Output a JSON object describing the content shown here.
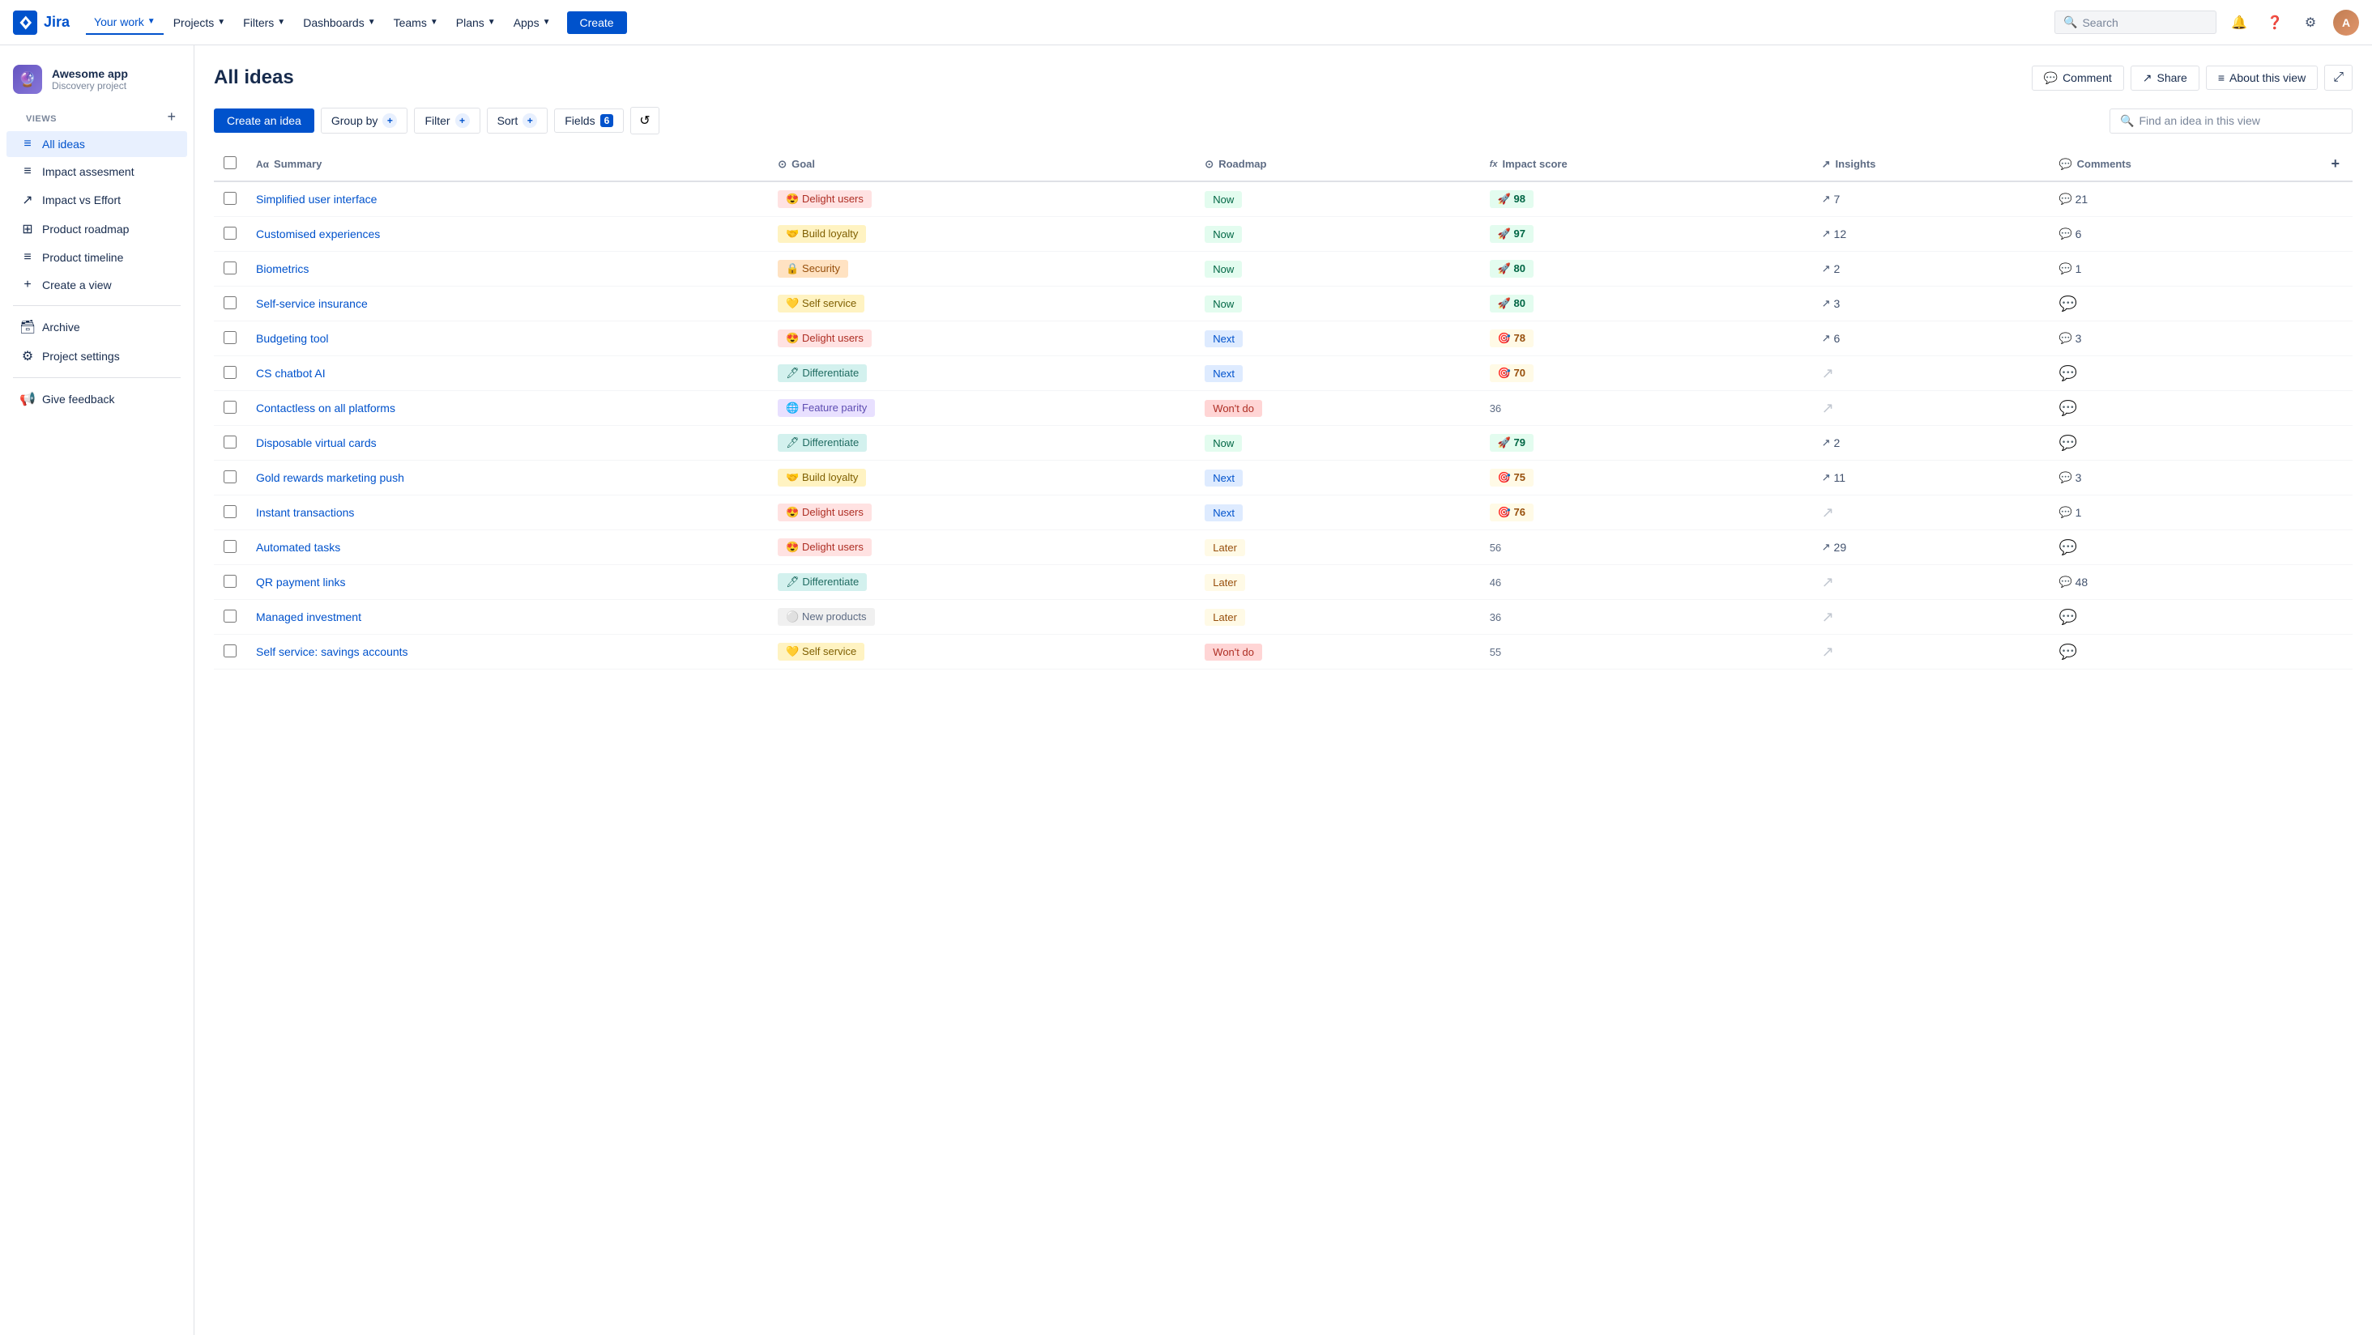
{
  "topnav": {
    "logo_text": "Jira",
    "menu": [
      {
        "label": "Your work",
        "active": true,
        "has_chevron": true
      },
      {
        "label": "Projects",
        "has_chevron": true
      },
      {
        "label": "Filters",
        "has_chevron": true
      },
      {
        "label": "Dashboards",
        "has_chevron": true
      },
      {
        "label": "Teams",
        "has_chevron": true
      },
      {
        "label": "Plans",
        "has_chevron": true
      },
      {
        "label": "Apps",
        "has_chevron": true
      }
    ],
    "create_label": "Create",
    "search_placeholder": "Search"
  },
  "sidebar": {
    "project_name": "Awesome app",
    "project_type": "Discovery project",
    "views_label": "VIEWS",
    "add_view_label": "+",
    "nav_items": [
      {
        "id": "all-ideas",
        "label": "All ideas",
        "icon": "≡",
        "active": true
      },
      {
        "id": "impact-assessment",
        "label": "Impact assesment",
        "icon": "≡"
      },
      {
        "id": "impact-vs-effort",
        "label": "Impact vs Effort",
        "icon": "↗"
      },
      {
        "id": "product-roadmap",
        "label": "Product roadmap",
        "icon": "⊞"
      },
      {
        "id": "product-timeline",
        "label": "Product timeline",
        "icon": "≡"
      },
      {
        "id": "create-view",
        "label": "Create a view",
        "icon": "+"
      }
    ],
    "archive_label": "Archive",
    "project_settings_label": "Project settings",
    "give_feedback_label": "Give feedback"
  },
  "main": {
    "title": "All ideas",
    "header_buttons": {
      "comment": "Comment",
      "share": "Share",
      "about": "About this view",
      "expand": "⤢"
    },
    "toolbar": {
      "create_idea": "Create an idea",
      "group_by": "Group by",
      "filter": "Filter",
      "sort": "Sort",
      "fields": "Fields",
      "fields_count": "6",
      "search_placeholder": "Find an idea in this view"
    },
    "table": {
      "columns": [
        {
          "id": "summary",
          "label": "Summary",
          "icon": "Aα"
        },
        {
          "id": "goal",
          "label": "Goal",
          "icon": "⊙"
        },
        {
          "id": "roadmap",
          "label": "Roadmap",
          "icon": "⊙"
        },
        {
          "id": "impact_score",
          "label": "Impact score",
          "icon": "fx"
        },
        {
          "id": "insights",
          "label": "Insights",
          "icon": "↗"
        },
        {
          "id": "comments",
          "label": "Comments",
          "icon": "💬"
        }
      ],
      "rows": [
        {
          "summary": "Simplified user interface",
          "goal_label": "Delight users",
          "goal_emoji": "😍",
          "goal_class": "goal-delight",
          "roadmap": "Now",
          "roadmap_class": "roadmap-now",
          "impact": 98,
          "impact_class": "impact-high",
          "impact_emoji": "🚀",
          "insights": 7,
          "comments": 21
        },
        {
          "summary": "Customised experiences",
          "goal_label": "Build loyalty",
          "goal_emoji": "🤝",
          "goal_class": "goal-loyalty",
          "roadmap": "Now",
          "roadmap_class": "roadmap-now",
          "impact": 97,
          "impact_class": "impact-high",
          "impact_emoji": "🚀",
          "insights": 12,
          "comments": 6
        },
        {
          "summary": "Biometrics",
          "goal_label": "Security",
          "goal_emoji": "🔒",
          "goal_class": "goal-security",
          "roadmap": "Now",
          "roadmap_class": "roadmap-now",
          "impact": 80,
          "impact_class": "impact-high",
          "impact_emoji": "🚀",
          "insights": 2,
          "comments": 1
        },
        {
          "summary": "Self-service insurance",
          "goal_label": "Self service",
          "goal_emoji": "💛",
          "goal_class": "goal-selfservice",
          "roadmap": "Now",
          "roadmap_class": "roadmap-now",
          "impact": 80,
          "impact_class": "impact-high",
          "impact_emoji": "🚀",
          "insights": 3,
          "comments": null
        },
        {
          "summary": "Budgeting tool",
          "goal_label": "Delight users",
          "goal_emoji": "😍",
          "goal_class": "goal-delight",
          "roadmap": "Next",
          "roadmap_class": "roadmap-next",
          "impact": 78,
          "impact_class": "impact-mid",
          "impact_emoji": "🎯",
          "insights": 6,
          "comments": 3
        },
        {
          "summary": "CS chatbot AI",
          "goal_label": "Differentiate",
          "goal_emoji": "🖊",
          "goal_class": "goal-differentiate",
          "roadmap": "Next",
          "roadmap_class": "roadmap-next",
          "impact": 70,
          "impact_class": "impact-mid",
          "impact_emoji": "🎯",
          "insights": null,
          "comments": null
        },
        {
          "summary": "Contactless on all platforms",
          "goal_label": "Feature parity",
          "goal_emoji": "🌐",
          "goal_class": "goal-featureparity",
          "roadmap": "Won't do",
          "roadmap_class": "roadmap-wontdo",
          "impact": 36,
          "impact_class": "impact-none",
          "impact_emoji": null,
          "insights": null,
          "comments": null
        },
        {
          "summary": "Disposable virtual cards",
          "goal_label": "Differentiate",
          "goal_emoji": "🖊",
          "goal_class": "goal-differentiate",
          "roadmap": "Now",
          "roadmap_class": "roadmap-now",
          "impact": 79,
          "impact_class": "impact-high",
          "impact_emoji": "🚀",
          "insights": 2,
          "comments": null
        },
        {
          "summary": "Gold rewards marketing push",
          "goal_label": "Build loyalty",
          "goal_emoji": "🤝",
          "goal_class": "goal-loyalty",
          "roadmap": "Next",
          "roadmap_class": "roadmap-next",
          "impact": 75,
          "impact_class": "impact-mid",
          "impact_emoji": "🎯",
          "insights": 11,
          "comments": 3
        },
        {
          "summary": "Instant transactions",
          "goal_label": "Delight users",
          "goal_emoji": "😍",
          "goal_class": "goal-delight",
          "roadmap": "Next",
          "roadmap_class": "roadmap-next",
          "impact": 76,
          "impact_class": "impact-mid",
          "impact_emoji": "🎯",
          "insights": null,
          "comments": 1
        },
        {
          "summary": "Automated tasks",
          "goal_label": "Delight users",
          "goal_emoji": "😍",
          "goal_class": "goal-delight",
          "roadmap": "Later",
          "roadmap_class": "roadmap-later",
          "impact": 56,
          "impact_class": "impact-none",
          "impact_emoji": null,
          "insights": 29,
          "comments": null
        },
        {
          "summary": "QR payment links",
          "goal_label": "Differentiate",
          "goal_emoji": "🖊",
          "goal_class": "goal-differentiate",
          "roadmap": "Later",
          "roadmap_class": "roadmap-later",
          "impact": 46,
          "impact_class": "impact-none",
          "impact_emoji": null,
          "insights": null,
          "comments": 48
        },
        {
          "summary": "Managed investment",
          "goal_label": "New products",
          "goal_emoji": "⚪",
          "goal_class": "goal-newproducts",
          "roadmap": "Later",
          "roadmap_class": "roadmap-later",
          "impact": 36,
          "impact_class": "impact-none",
          "impact_emoji": null,
          "insights": null,
          "comments": null
        },
        {
          "summary": "Self service: savings accounts",
          "goal_label": "Self service",
          "goal_emoji": "💛",
          "goal_class": "goal-selfservice",
          "roadmap": "Won't do",
          "roadmap_class": "roadmap-wontdo",
          "impact": 55,
          "impact_class": "impact-none",
          "impact_emoji": null,
          "insights": null,
          "comments": null
        }
      ]
    }
  }
}
